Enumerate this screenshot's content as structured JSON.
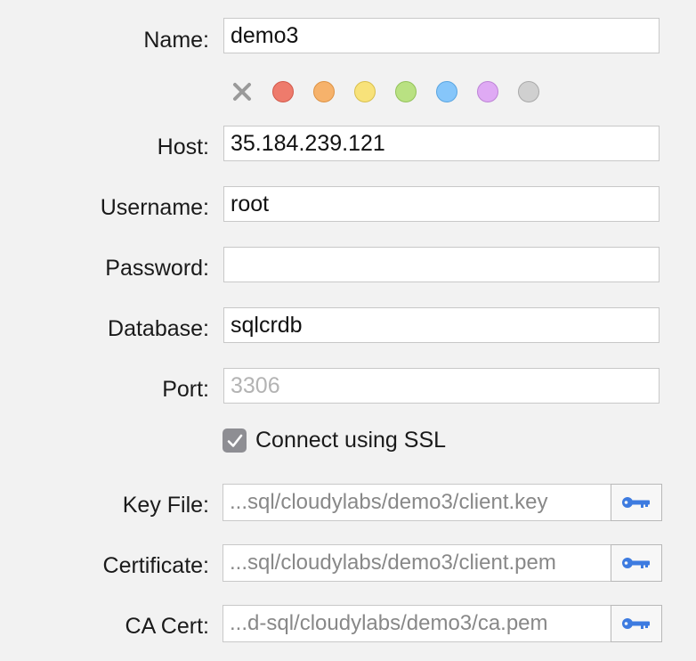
{
  "form": {
    "name": {
      "label": "Name:",
      "value": "demo3"
    },
    "colors": {
      "clear_icon": "clear-color-x-icon",
      "swatches": [
        {
          "name": "red",
          "fill": "#ee7b6c",
          "stroke": "#d2594b"
        },
        {
          "name": "orange",
          "fill": "#f6b26b",
          "stroke": "#dd9244"
        },
        {
          "name": "yellow",
          "fill": "#f8e27a",
          "stroke": "#d8bf4d"
        },
        {
          "name": "green",
          "fill": "#b9e182",
          "stroke": "#93c25b"
        },
        {
          "name": "blue",
          "fill": "#86c6fa",
          "stroke": "#5aa5e0"
        },
        {
          "name": "purple",
          "fill": "#dfaaf4",
          "stroke": "#bd84d6"
        },
        {
          "name": "gray",
          "fill": "#d0d0d0",
          "stroke": "#a9a9a9"
        }
      ]
    },
    "host": {
      "label": "Host:",
      "value": "35.184.239.121"
    },
    "username": {
      "label": "Username:",
      "value": "root"
    },
    "password": {
      "label": "Password:",
      "value": ""
    },
    "database": {
      "label": "Database:",
      "value": "sqlcrdb"
    },
    "port": {
      "label": "Port:",
      "value": "",
      "placeholder": "3306"
    },
    "ssl": {
      "label": "Connect using SSL",
      "checked": true
    },
    "key_file": {
      "label": "Key File:",
      "value": "...sql/cloudylabs/demo3/client.key",
      "button_icon": "key-icon"
    },
    "certificate": {
      "label": "Certificate:",
      "value": "...sql/cloudylabs/demo3/client.pem",
      "button_icon": "key-icon"
    },
    "ca_cert": {
      "label": "CA Cert:",
      "value": "...d-sql/cloudylabs/demo3/ca.pem",
      "button_icon": "key-icon"
    }
  },
  "accent_color": "#3d7be0"
}
